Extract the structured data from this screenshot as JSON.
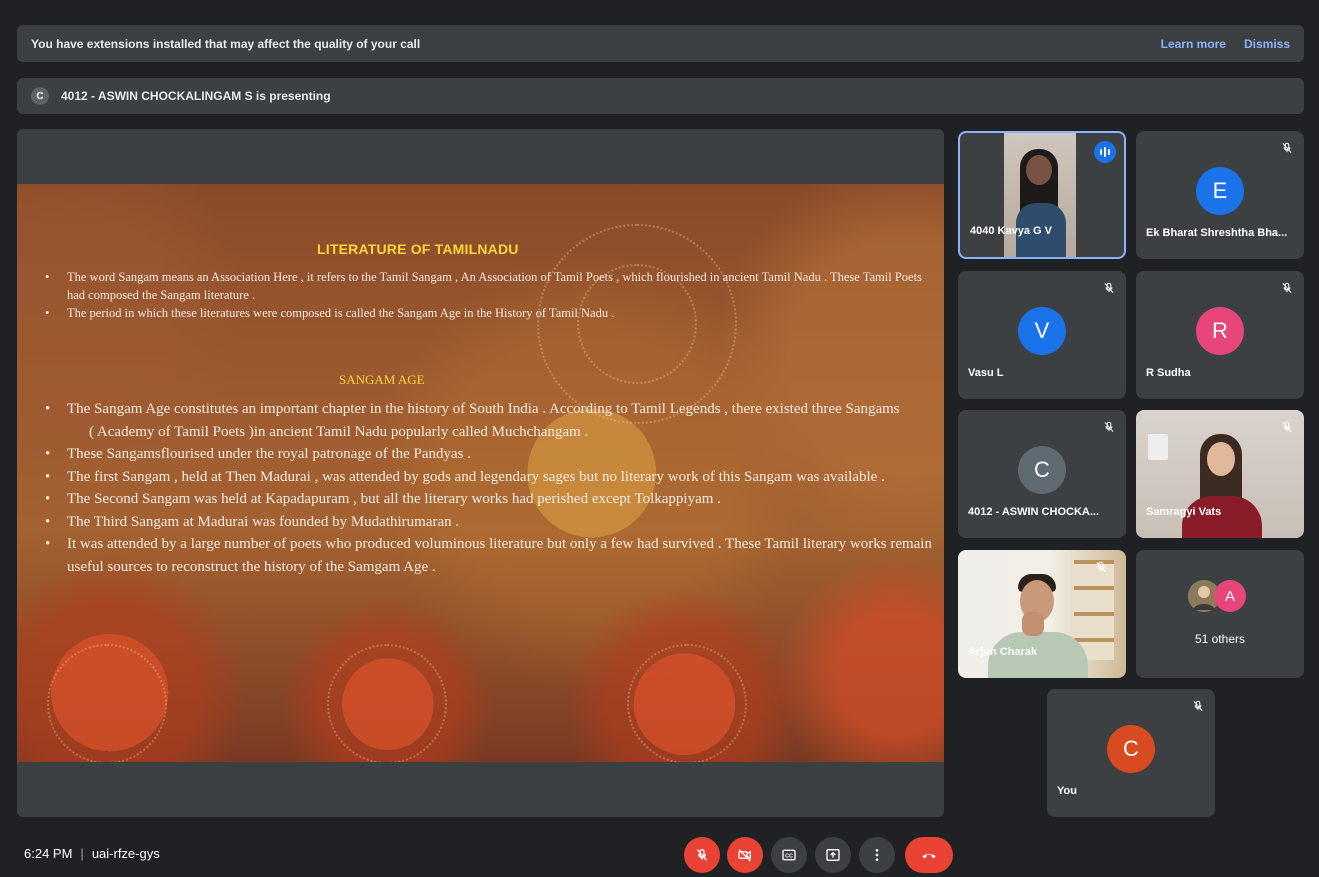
{
  "extension_banner": {
    "message": "You have extensions installed that may affect the quality of your call",
    "learn_more": "Learn more",
    "dismiss": "Dismiss"
  },
  "presenting_banner": {
    "avatar_letter": "C",
    "text": "4012 - ASWIN CHOCKALINGAM S is presenting"
  },
  "slide": {
    "title": "LITERATURE OF TAMILNADU",
    "bullets_top": [
      "The word Sangam means an Association Here , it refers to the Tamil Sangam , An Association of Tamil Poets , which flourished in ancient Tamil Nadu . These Tamil Poets had composed the Sangam literature .",
      "The period in which these literatures were composed is called the Sangam Age in the History of Tamil Nadu ."
    ],
    "subtitle": "SANGAM AGE",
    "bullets_bottom": [
      "The Sangam Age constitutes an important chapter in the history of South India . According to Tamil Legends , there existed three Sangams",
      "( Academy of Tamil Poets )in ancient Tamil Nadu popularly called Muchchangam .",
      "These Sangamsflourised under the royal patronage of the Pandyas .",
      "The first Sangam , held at Then Madurai , was attended by gods and legendary sages but no literary work of this Sangam was available .",
      "The Second Sangam was held at Kapadapuram , but all the literary works had perished except Tolkappiyam .",
      "The Third Sangam at Madurai was founded by Mudathirumaran .",
      "It was attended by a large number of poets who produced voluminous literature but only a few had survived . These Tamil literary works remain useful sources to reconstruct the history of the Samgam Age ."
    ]
  },
  "participants": {
    "kavya": {
      "name": "4040 Kavya G V"
    },
    "ek": {
      "name": "Ek Bharat Shreshtha Bha...",
      "letter": "E",
      "color": "#1a73e8"
    },
    "vasu": {
      "name": "Vasu L",
      "letter": "V",
      "color": "#1a73e8"
    },
    "rsudha": {
      "name": "R Sudha",
      "letter": "R",
      "color": "#e8457a"
    },
    "aswin": {
      "name": "4012 - ASWIN CHOCKA...",
      "letter": "C",
      "color": "#5f6a73"
    },
    "samragyi": {
      "name": "Samragyi Vats"
    },
    "arjun": {
      "name": "Arjun Charak"
    },
    "others": {
      "label": "51 others",
      "letter": "A",
      "color": "#e8457a"
    },
    "you": {
      "name": "You",
      "letter": "C",
      "color": "#d84a1f"
    }
  },
  "footer": {
    "time": "6:24 PM",
    "separator": "|",
    "meeting_code": "uai-rfze-gys"
  },
  "icons": {
    "mic_off": "mic-off-icon",
    "camera_off": "camera-off-icon",
    "captions": "captions-icon",
    "present": "present-icon",
    "more": "more-vert-icon",
    "leave": "call-end-icon"
  }
}
